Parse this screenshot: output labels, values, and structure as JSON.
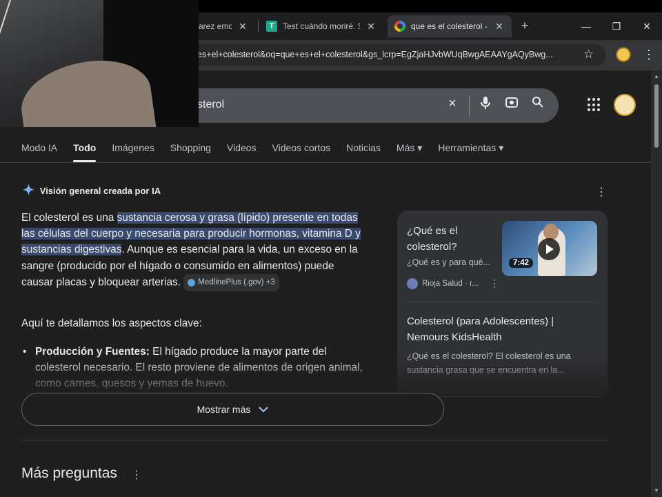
{
  "browser": {
    "tabs": [
      {
        "title": "arez emoc",
        "favicon": "none"
      },
      {
        "title": "Test cuándo moriré. Sa",
        "favicon": "T"
      },
      {
        "title": "que es el colesterol - B",
        "favicon": "google",
        "active": true
      }
    ],
    "url": "es+el+colesterol&oq=que+es+el+colesterol&gs_lcrp=EgZjaHJvbWUqBwgAEAAYgAQyBwg..."
  },
  "search": {
    "query": "sterol",
    "clear_icon": "×"
  },
  "nav": {
    "tabs": [
      "Modo IA",
      "Todo",
      "Imágenes",
      "Shopping",
      "Videos",
      "Videos cortos",
      "Noticias",
      "Más ▾",
      "Herramientas ▾"
    ]
  },
  "ai_overview": {
    "header": "Visión general creada por IA",
    "intro_plain": "El colesterol es una ",
    "intro_highlight": "sustancia cerosa y grasa (lípido) presente en todas las células del cuerpo y necesaria para producir hormonas, vitamina D y sustancias digestivas",
    "intro_rest": ". Aunque es esencial para la vida, un exceso en la sangre (producido por el hígado o consumido en alimentos) puede causar placas y bloquear arterias.",
    "source_chip": "MedlinePlus (.gov) +3",
    "subheading": "Aquí te detallamos los aspectos clave:",
    "bullet_bold": "Producción y Fuentes:",
    "bullet_text": " El hígado produce la mayor parte del colesterol necesario. El resto proviene de alimentos de origen animal, como carnes, quesos y yemas de huevo.",
    "show_more": "Mostrar más"
  },
  "side_card": {
    "item1_title": "¿Qué es el colesterol?",
    "item1_desc": "¿Qué es y para qué...",
    "item1_source": "Rioja Salud · r...",
    "video_duration": "7:42",
    "item2_title": "Colesterol (para Adolescentes) | Nemours KidsHealth",
    "item2_desc": "¿Qué es el colesterol? El colesterol es una sustancia grasa que se encuentra en la..."
  },
  "more_questions": {
    "title": "Más preguntas"
  }
}
